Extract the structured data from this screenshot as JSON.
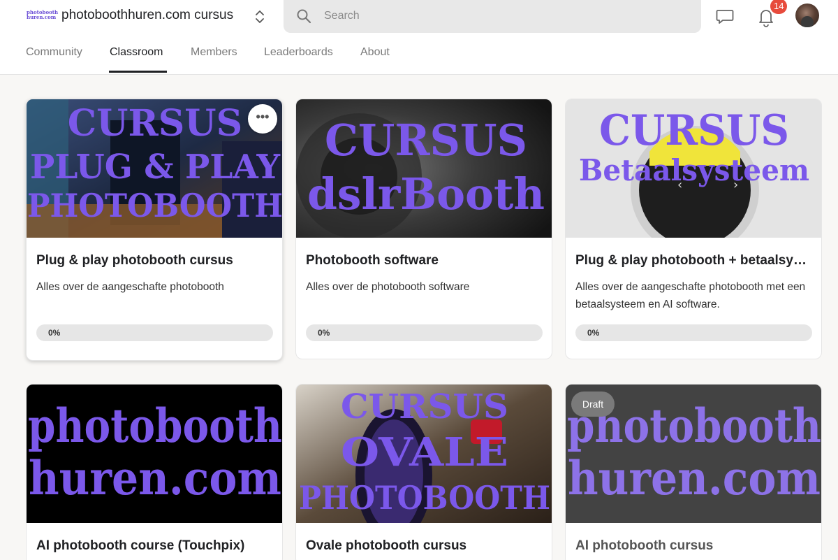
{
  "header": {
    "logo_line1": "photobooth",
    "logo_line2": "huren.com",
    "group_title": "photoboothhuren.com cursus",
    "search_placeholder": "Search",
    "notification_count": "14"
  },
  "tabs": [
    {
      "label": "Community",
      "active": false
    },
    {
      "label": "Classroom",
      "active": true
    },
    {
      "label": "Members",
      "active": false
    },
    {
      "label": "Leaderboards",
      "active": false
    },
    {
      "label": "About",
      "active": false
    }
  ],
  "colors": {
    "accent": "#7b58ea",
    "progress_track": "#e6e6e6",
    "badge": "#e74b3c"
  },
  "courses": [
    {
      "title": "Plug & play photobooth cursus",
      "description": "Alles over de aangeschafte photobooth",
      "progress_label": "0%",
      "progress": 0,
      "thumb_text": [
        "CURSUS",
        "PLUG & PLAY",
        "PHOTOBOOTH"
      ]
    },
    {
      "title": "Photobooth software",
      "description": "Alles over de photobooth software",
      "progress_label": "0%",
      "progress": 0,
      "thumb_text": [
        "CURSUS",
        "dslrBooth"
      ]
    },
    {
      "title": "Plug & play photobooth + betaalsy…",
      "description": "Alles over de aangeschafte photobooth met een betaalsysteem en AI software.",
      "progress_label": "0%",
      "progress": 0,
      "thumb_text": [
        "CURSUS",
        "Betaalsysteem"
      ]
    },
    {
      "title": "AI photobooth course (Touchpix)",
      "thumb_text": [
        "photobooth",
        "huren.com"
      ]
    },
    {
      "title": "Ovale photobooth cursus",
      "thumb_text": [
        "CURSUS",
        "OVALE",
        "PHOTOBOOTH"
      ]
    },
    {
      "title": "AI photobooth cursus",
      "badge": "Draft",
      "thumb_text": [
        "photobooth",
        "huren.com"
      ]
    }
  ],
  "icons": {
    "more": "more-horizontal-icon",
    "search": "search-icon",
    "chat": "chat-icon",
    "bell": "bell-icon",
    "switch": "chevron-up-down-icon"
  }
}
